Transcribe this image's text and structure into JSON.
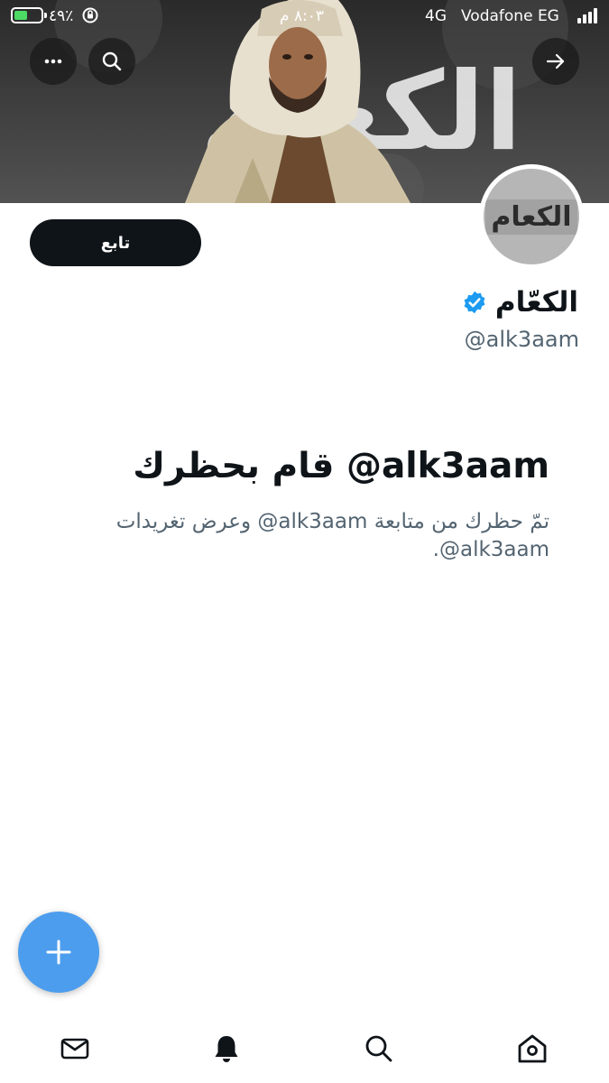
{
  "status_bar": {
    "battery": "٤٩٪",
    "battery_level": 0.49,
    "time": "٨:٠٣ م",
    "network": "4G",
    "carrier": "Vodafone EG"
  },
  "banner": {
    "watermark_text": "الكعام"
  },
  "profile": {
    "avatar_logo_text": "الكعام",
    "follow_label": "تابع",
    "display_name": "الكعّام",
    "handle": "@alk3aam",
    "verified": true,
    "verified_color": "#1d9bf0"
  },
  "blocked_notice": {
    "title": "alk3aam@ قام بحظرك",
    "description": "تمّ حظرك من متابعة alk3aam@ وعرض تغريدات alk3aam@."
  },
  "icons": {
    "more": "more-icon",
    "search": "search-icon",
    "back": "arrow-right-icon",
    "compose": "plus-icon",
    "messages": "mail-icon",
    "notifications": "bell-icon",
    "explore": "search-icon",
    "home": "home-icon"
  },
  "colors": {
    "accent": "#4c9ded",
    "text_primary": "#0f1419",
    "text_secondary": "#536471"
  }
}
